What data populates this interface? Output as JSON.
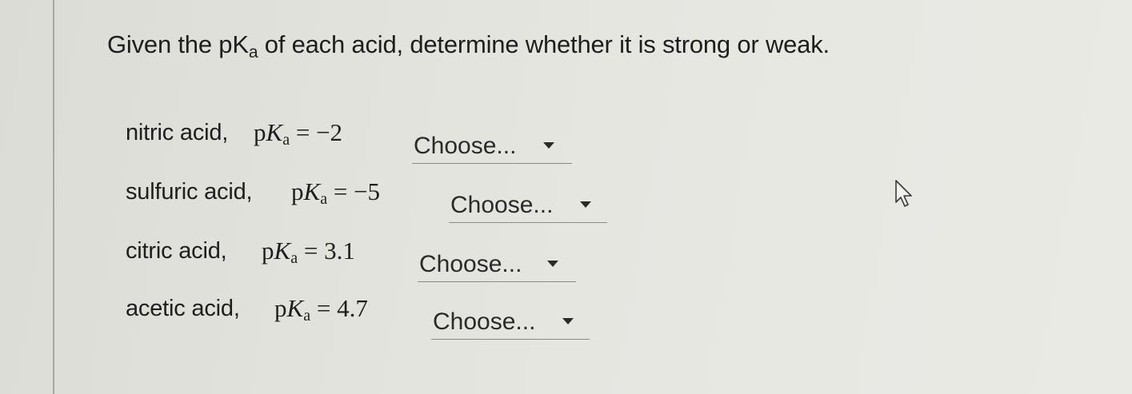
{
  "question": {
    "prefix": "Given the pK",
    "subscript": "a",
    "suffix": " of each acid, determine whether it is strong or weak."
  },
  "rows": [
    {
      "acid": "nitric acid,",
      "p": "p",
      "k": "K",
      "sub": "a",
      "eq": " = ",
      "value": "−2",
      "dropdown": "Choose..."
    },
    {
      "acid": "sulfuric acid,",
      "p": "p",
      "k": "K",
      "sub": "a",
      "eq": " = ",
      "value": "−5",
      "dropdown": "Choose..."
    },
    {
      "acid": "citric acid,",
      "p": "p",
      "k": "K",
      "sub": "a",
      "eq": " = ",
      "value": "3.1",
      "dropdown": "Choose..."
    },
    {
      "acid": "acetic acid,",
      "p": "p",
      "k": "K",
      "sub": "a",
      "eq": " = ",
      "value": "4.7",
      "dropdown": "Choose..."
    }
  ],
  "icons": {
    "dropdown_caret": "caret-down-icon",
    "pointer": "mouse-pointer-icon"
  },
  "colors": {
    "background": "#e3e3dd",
    "text": "#1e1e1e",
    "underline": "#8a8a86"
  }
}
